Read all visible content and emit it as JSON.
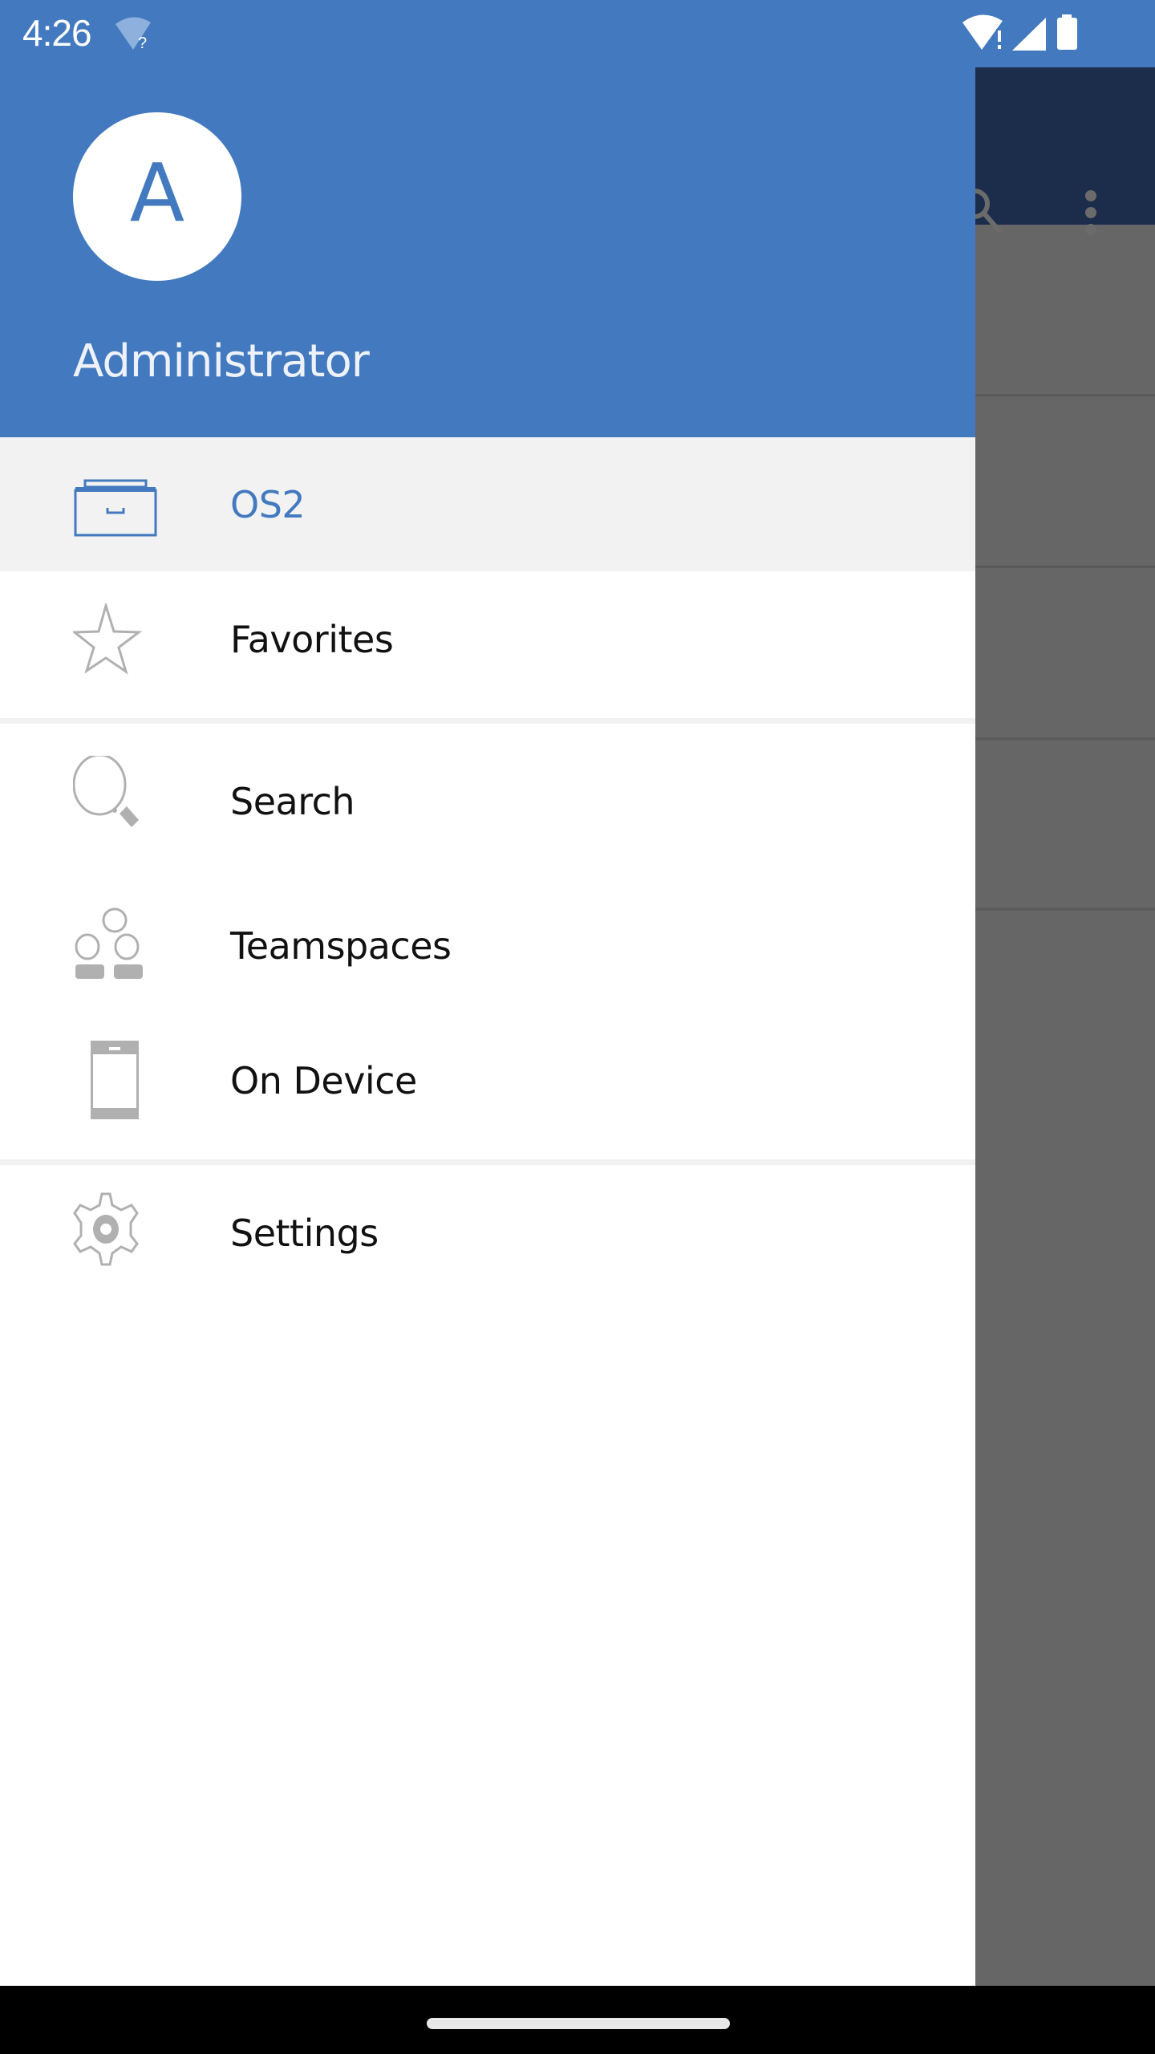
{
  "status_bar": {
    "time": "4:26",
    "icons": [
      "wifi-unknown-icon",
      "wifi-alert-icon",
      "cellular-signal-icon",
      "battery-icon"
    ]
  },
  "background_app": {
    "toolbar_icons": [
      "search-icon",
      "more-vert-icon"
    ]
  },
  "drawer": {
    "header": {
      "avatar_letter": "A",
      "user_name": "Administrator"
    },
    "items": [
      {
        "label": "OS2",
        "icon": "repository-icon",
        "active": true
      },
      {
        "label": "Favorites",
        "icon": "star-icon",
        "active": false
      },
      {
        "label": "Search",
        "icon": "search-icon",
        "active": false
      },
      {
        "label": "Teamspaces",
        "icon": "teamspaces-icon",
        "active": false
      },
      {
        "label": "On Device",
        "icon": "device-icon",
        "active": false
      },
      {
        "label": "Settings",
        "icon": "gear-icon",
        "active": false
      }
    ]
  },
  "colors": {
    "accent": "#4379BF",
    "toolbar_bg": "#1B2D4B",
    "active_item_bg": "#F2F2F2",
    "icon_grey": "#B0B0B0",
    "scrim": "#666666"
  }
}
